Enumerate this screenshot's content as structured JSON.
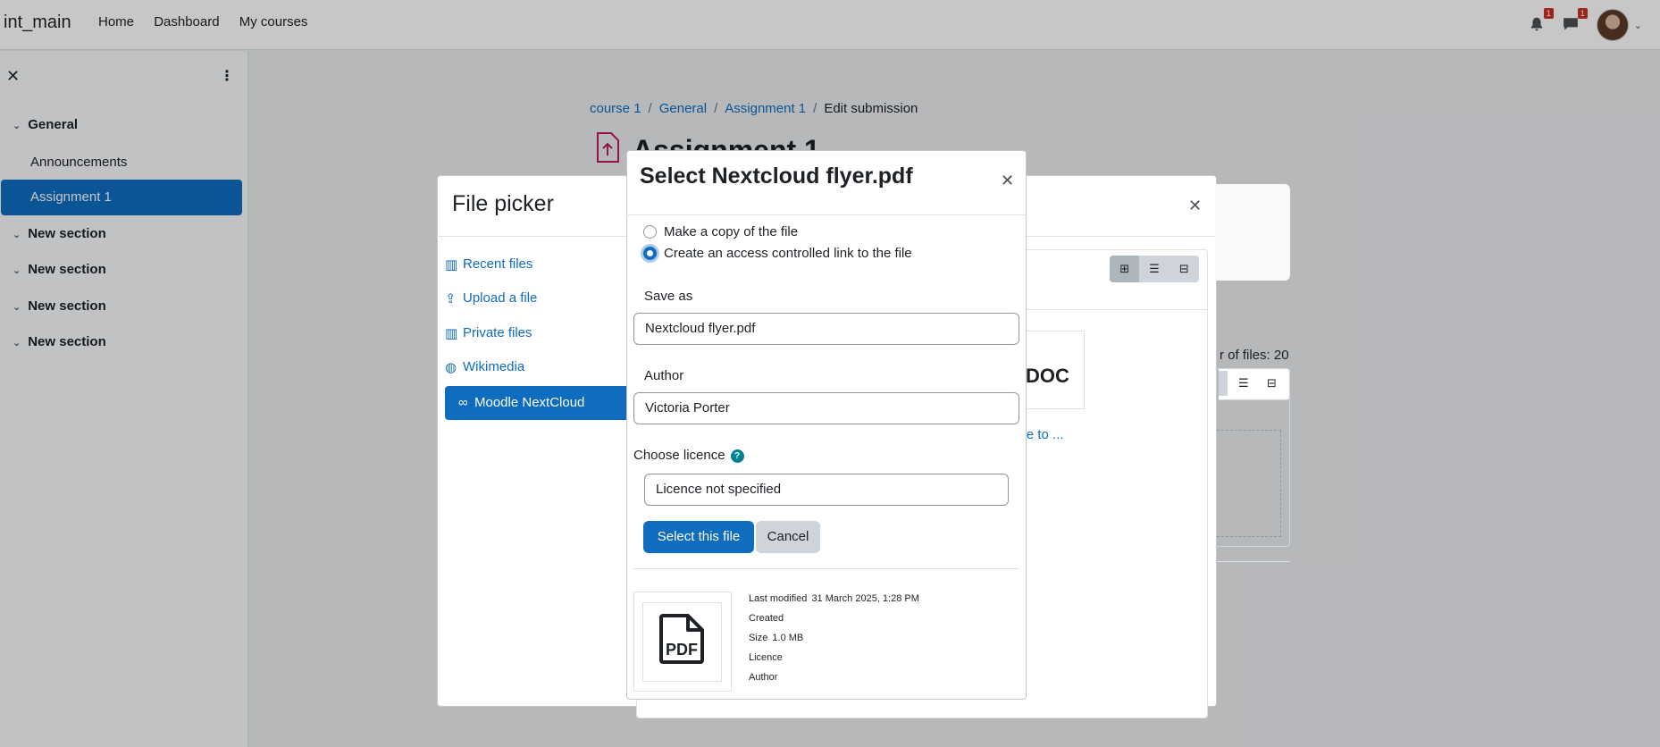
{
  "navbar": {
    "brand": "int_main",
    "links": [
      "Home",
      "Dashboard",
      "My courses"
    ],
    "notifications_count": "1",
    "messages_count": "1"
  },
  "drawer": {
    "sections": [
      {
        "label": "General"
      },
      {
        "label": "New section"
      },
      {
        "label": "New section"
      },
      {
        "label": "New section"
      },
      {
        "label": "New section"
      }
    ],
    "sub_items": [
      "Announcements",
      "Assignment 1"
    ]
  },
  "breadcrumb": [
    "course 1",
    "General",
    "Assignment 1",
    "Edit submission"
  ],
  "page_title": "Assignment 1",
  "file_picker": {
    "title": "File picker",
    "repositories": [
      "Recent files",
      "Upload a file",
      "Private files",
      "Wikimedia",
      "Moodle NextCloud"
    ],
    "file_icon_text": "DOC",
    "file_name_partial": "ome to ...",
    "files_count_partial": "r of files: 20"
  },
  "dialog": {
    "title": "Select Nextcloud flyer.pdf",
    "radio_copy": "Make a copy of the file",
    "radio_link": "Create an access controlled link to the file",
    "save_as_label": "Save as",
    "save_as_value": "Nextcloud flyer.pdf",
    "author_label": "Author",
    "author_value": "Victoria Porter",
    "licence_label": "Choose licence",
    "licence_value": "Licence not specified",
    "select_button": "Select this file",
    "cancel_button": "Cancel",
    "thumb_text": "PDF",
    "meta": {
      "last_modified_label": "Last modified",
      "last_modified_value": "31 March 2025, 1:28 PM",
      "created_label": "Created",
      "size_label": "Size",
      "size_value": "1.0 MB",
      "licence_label": "Licence",
      "author_label": "Author"
    }
  },
  "colors": {
    "primary": "#0f6cbf",
    "danger_badge": "#ca3120",
    "help_icon": "#008196"
  }
}
